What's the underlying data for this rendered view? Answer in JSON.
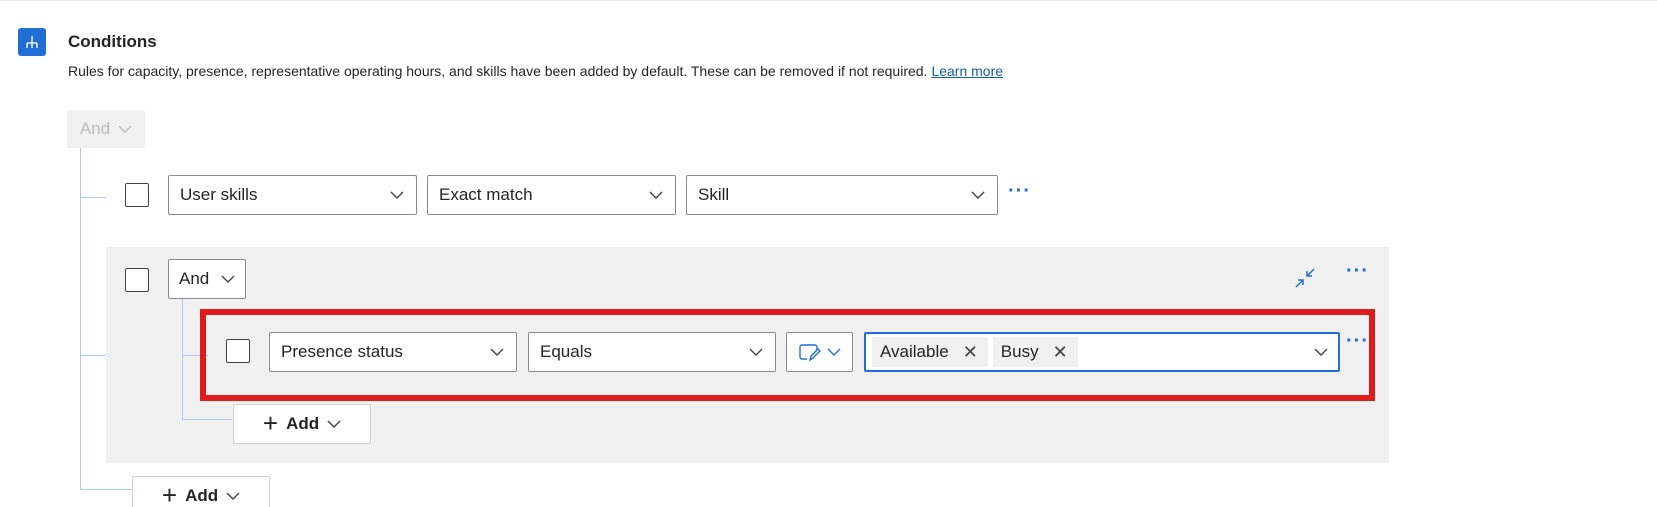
{
  "conditions": {
    "icon": "hierarchy-icon",
    "title": "Conditions",
    "description": "Rules for capacity, presence, representative operating hours, and skills have been added by default. These can be removed if not required.",
    "learn_more": "Learn more",
    "root_operator": "And",
    "rule_1": {
      "field": "User skills",
      "operator": "Exact match",
      "value": "Skill",
      "more": "···"
    },
    "group": {
      "operator": "And",
      "more": "···",
      "collapse_icon": "collapse-arrows-icon",
      "rule": {
        "field": "Presence status",
        "operator": "Equals",
        "value_type_icon": "edit-box-icon",
        "tags": [
          "Available",
          "Busy"
        ],
        "more": "···"
      },
      "add_label": "Add"
    },
    "add_label": "Add"
  },
  "colors": {
    "accent": "#1f6fd6",
    "highlight": "#e01b1b",
    "group_bg": "#f0f0f0",
    "connector": "#b3c9ea"
  }
}
